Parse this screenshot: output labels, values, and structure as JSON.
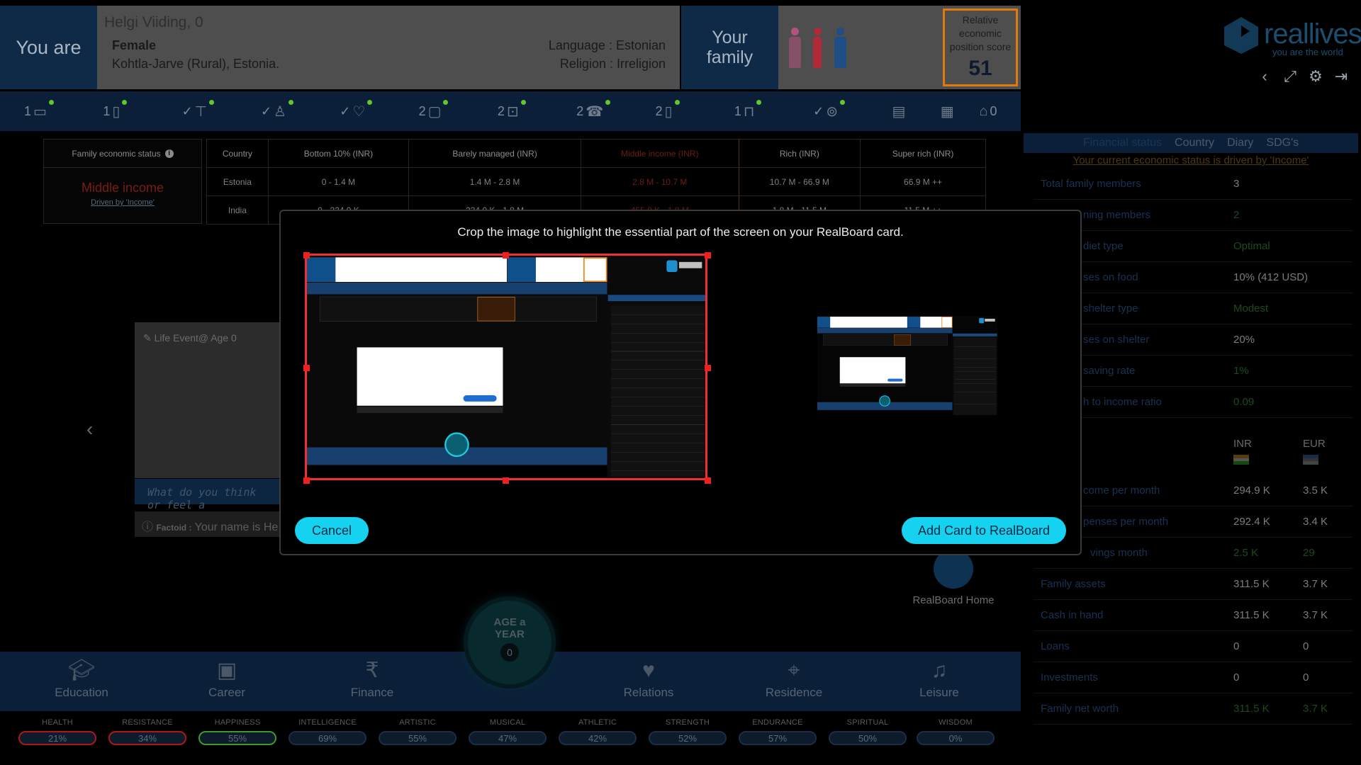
{
  "header": {
    "you_are": "You are",
    "name": "Helgi Viiding, 0",
    "gender": "Female",
    "location": "Kohtla-Jarve (Rural), Estonia.",
    "language": "Language : Estonian",
    "religion": "Religion : Irreligion",
    "your_family": "Your family",
    "score_label": "Relative economic position score",
    "score_value": "51",
    "family_colors": [
      "#b5527d",
      "#b02a3a",
      "#1f4e86"
    ]
  },
  "logo": {
    "word": "reallives",
    "tagline": "you are the world"
  },
  "top_tools": [
    "back-icon",
    "expand-icon",
    "settings-icon",
    "logout-icon"
  ],
  "status_bar": [
    {
      "prefix": "1",
      "icon": "computer-icon",
      "dot": true
    },
    {
      "prefix": "1",
      "icon": "phone-icon",
      "dot": true
    },
    {
      "prefix": "✓",
      "icon": "tap-icon",
      "dot": true
    },
    {
      "prefix": "✓",
      "icon": "toilet-icon",
      "dot": true
    },
    {
      "prefix": "✓",
      "icon": "health-icon",
      "dot": true
    },
    {
      "prefix": "2",
      "icon": "tv-icon",
      "dot": true
    },
    {
      "prefix": "2",
      "icon": "radio-icon",
      "dot": true
    },
    {
      "prefix": "2",
      "icon": "telephone-icon",
      "dot": true
    },
    {
      "prefix": "2",
      "icon": "mobile-icon",
      "dot": true
    },
    {
      "prefix": "1",
      "icon": "car-icon",
      "dot": true
    },
    {
      "prefix": "✓",
      "icon": "wifi-icon",
      "dot": true
    },
    {
      "prefix": "",
      "icon": "books-icon",
      "dot": false
    },
    {
      "prefix": "",
      "icon": "shop-icon",
      "dot": false
    },
    {
      "prefix": "0",
      "icon": "house-icon",
      "dot": false,
      "suffix": true
    }
  ],
  "econ": {
    "status_label": "Family economic status",
    "status_value": "Middle income",
    "driven": "Driven by 'Income'",
    "headers": [
      "Country",
      "Bottom 10% (INR)",
      "Barely managed (INR)",
      "Middle income (INR)",
      "Rich (INR)",
      "Super rich (INR)"
    ],
    "rows": [
      [
        "Estonia",
        "0 - 1.4 M",
        "1.4 M - 2.8 M",
        "2.8 M - 10.7 M",
        "10.7 M - 66.9 M",
        "66.9 M ++"
      ],
      [
        "India",
        "0 - 234.0 K",
        "234.0 K - 1.8 M",
        "455.0 K - 1.8 M",
        "1.8 M - 11.5 M",
        "11.5 M ++"
      ]
    ]
  },
  "life": {
    "event_title": "Life Event@ Age 0",
    "think_placeholder": "What do you think or feel a",
    "factoid_label": "Factoid :",
    "factoid_text": "Your name is He",
    "realboard_home": "RealBoard Home"
  },
  "nav": {
    "items": [
      "Education",
      "Career",
      "Finance",
      "Relations",
      "Residence",
      "Leisure"
    ],
    "age_button": "AGE a YEAR",
    "age_value": "0"
  },
  "stats": [
    {
      "label": "HEALTH",
      "value": "21%",
      "color": "#b01818"
    },
    {
      "label": "RESISTANCE",
      "value": "34%",
      "color": "#b01818"
    },
    {
      "label": "HAPPINESS",
      "value": "55%",
      "color": "#3f9a28"
    },
    {
      "label": "INTELLIGENCE",
      "value": "69%",
      "color": "#1a2e46"
    },
    {
      "label": "ARTISTIC",
      "value": "55%",
      "color": "#1a2e46"
    },
    {
      "label": "MUSICAL",
      "value": "47%",
      "color": "#1a2e46"
    },
    {
      "label": "ATHLETIC",
      "value": "42%",
      "color": "#1a2e46"
    },
    {
      "label": "STRENGTH",
      "value": "52%",
      "color": "#1a2e46"
    },
    {
      "label": "ENDURANCE",
      "value": "57%",
      "color": "#1a2e46"
    },
    {
      "label": "SPIRITUAL",
      "value": "50%",
      "color": "#1a2e46"
    },
    {
      "label": "WISDOM",
      "value": "0%",
      "color": "#1a2e46"
    }
  ],
  "finance": {
    "tabs": [
      "Financial status",
      "Country",
      "Diary",
      "SDG's"
    ],
    "driven": "Your current economic status is driven by 'Income'",
    "rows_top": [
      {
        "k": "Total family members",
        "v": "3",
        "style": ""
      },
      {
        "k": "Earning members",
        "v": "2",
        "style": "g",
        "visible_k": "ning members"
      },
      {
        "k": "Current diet type",
        "v": "Optimal",
        "style": "g",
        "visible_k": "diet type"
      },
      {
        "k": "% Expenses on food",
        "v": "10% (412 USD)",
        "style": "",
        "visible_k": "ses on food"
      },
      {
        "k": "Current shelter type",
        "v": "Modest",
        "style": "g",
        "visible_k": "shelter type"
      },
      {
        "k": "% Expenses on shelter",
        "v": "20%",
        "style": "",
        "visible_k": "ses on shelter"
      },
      {
        "k": "Current saving rate",
        "v": "1%",
        "style": "g",
        "visible_k": "saving rate"
      },
      {
        "k": "Net worth to income ratio",
        "v": "0.09",
        "style": "g",
        "visible_k": "h to income ratio"
      }
    ],
    "currency_1": "INR",
    "currency_2": "EUR",
    "rows_bottom": [
      {
        "k": "come per month",
        "v1": "294.9 K",
        "v2": "3.5 K",
        "style": ""
      },
      {
        "k": "penses per month",
        "v1": "292.4 K",
        "v2": "3.4 K",
        "style": ""
      },
      {
        "k": "vings month",
        "v1": "2.5 K",
        "v2": "29",
        "style": "g"
      },
      {
        "k": "Family assets",
        "v1": "311.5 K",
        "v2": "3.7 K",
        "style": ""
      },
      {
        "k": "Cash in hand",
        "v1": "311.5 K",
        "v2": "3.7 K",
        "style": ""
      },
      {
        "k": "Loans",
        "v1": "0",
        "v2": "0",
        "style": ""
      },
      {
        "k": "Investments",
        "v1": "0",
        "v2": "0",
        "style": ""
      },
      {
        "k": "Family net worth",
        "v1": "311.5 K",
        "v2": "3.7 K",
        "style": "g"
      }
    ]
  },
  "modal": {
    "title": "Crop the image to highlight the essential part of the screen on your RealBoard card.",
    "cancel": "Cancel",
    "add": "Add Card to RealBoard"
  }
}
